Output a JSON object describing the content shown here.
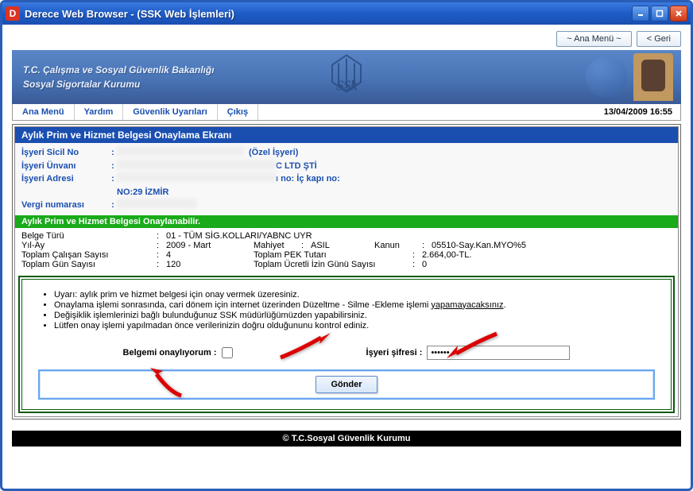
{
  "window": {
    "title": "Derece Web Browser - (SSK Web İşlemleri)"
  },
  "top_buttons": {
    "main_menu": "~ Ana Menü ~",
    "back": "<  Geri"
  },
  "banner": {
    "line1": "T.C. Çalışma ve Sosyal Güvenlik Bakanlığı",
    "line2": "Sosyal Sigortalar Kurumu",
    "logo_text": "SSk"
  },
  "menu": {
    "items": [
      "Ana Menü",
      "Yardım",
      "Güvenlik Uyarıları",
      "Çıkış"
    ],
    "datetime": "13/04/2009 16:55"
  },
  "page": {
    "title": "Aylık Prim ve Hizmet Belgesi Onaylama Ekranı",
    "info": {
      "sicil_no_label": "İşyeri Sicil No",
      "sicil_no_suffix": "(Özel İşyeri)",
      "unvan_label": "İşyeri Ünvanı",
      "unvan_suffix": "C LTD ŞTİ",
      "adres_label": "İşyeri Adresi",
      "adres_suffix_top": "ı no: İç kapı no:",
      "adres_line2": "NO:29 İZMİR",
      "vergi_label": "Vergi numarası"
    },
    "green_title": "Aylık Prim ve Hizmet Belgesi Onaylanabilir.",
    "details": {
      "belge_turu_lbl": "Belge Türü",
      "belge_turu_val": "01 - TÜM SİG.KOLLARI/YABNC UYR",
      "yil_ay_lbl": "Yıl-Ay",
      "yil_ay_val": "2009 - Mart",
      "mahiyet_lbl": "Mahiyet",
      "mahiyet_val": "ASIL",
      "kanun_lbl": "Kanun",
      "kanun_val": "05510-Say.Kan.MYO%5",
      "calisan_lbl": "Toplam Çalışan Sayısı",
      "calisan_val": "4",
      "pek_lbl": "Toplam PEK Tutarı",
      "pek_val": "2.664,00-TL.",
      "gun_lbl": "Toplam Gün Sayısı",
      "gun_val": "120",
      "izin_lbl": "Toplam Ücretli İzin Günü Sayısı",
      "izin_val": "0"
    },
    "warnings": {
      "w1": "Uyarı: aylık prim ve hizmet belgesi için onay vermek üzeresiniz.",
      "w2a": "Onaylama işlemi sonrasında, cari dönem için internet üzerinden Düzeltme - Silme -Ekleme işlemi ",
      "w2b": "yapamayacaksınız",
      "w2c": ".",
      "w3": "Değişiklik işlemlerinizi bağlı bulunduğunuz SSK müdürlüğümüzden yapabilirsiniz.",
      "w4": "Lütfen onay işlemi yapılmadan önce verilerinizin doğru olduğununu kontrol ediniz."
    },
    "form": {
      "confirm_label": "Belgemi onaylıyorum   :",
      "password_label": "İşyeri şifresi    :",
      "password_value": "••••••",
      "submit": "Gönder"
    }
  },
  "footer": "© T.C.Sosyal Güvenlik Kurumu"
}
